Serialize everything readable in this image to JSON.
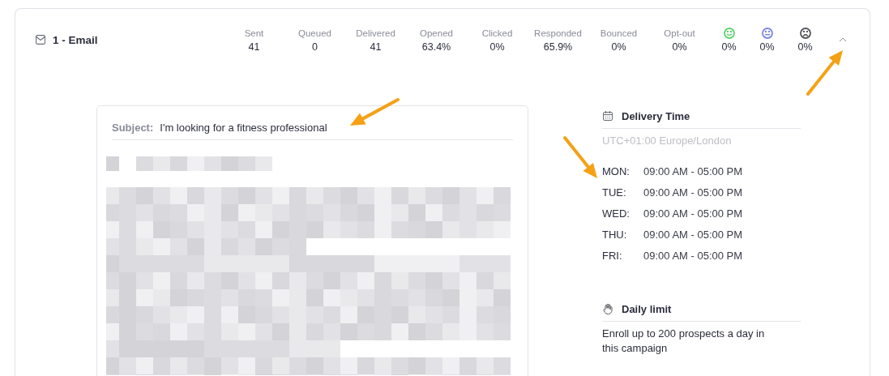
{
  "step": {
    "title": "1 - Email",
    "expanded": true
  },
  "stats": [
    {
      "kind": "text",
      "label": "Sent",
      "value": "41"
    },
    {
      "kind": "text",
      "label": "Queued",
      "value": "0"
    },
    {
      "kind": "text",
      "label": "Delivered",
      "value": "41"
    },
    {
      "kind": "text",
      "label": "Opened",
      "value": "63.4%"
    },
    {
      "kind": "text",
      "label": "Clicked",
      "value": "0%"
    },
    {
      "kind": "text",
      "label": "Responded",
      "value": "65.9%"
    },
    {
      "kind": "text",
      "label": "Bounced",
      "value": "0%"
    },
    {
      "kind": "text",
      "label": "Opt-out",
      "value": "0%"
    },
    {
      "kind": "smile",
      "color": "#5ed36b",
      "value": "0%"
    },
    {
      "kind": "neutral",
      "color": "#7b86e8",
      "value": "0%"
    },
    {
      "kind": "frown",
      "color": "#55565e",
      "value": "0%"
    }
  ],
  "email": {
    "subject_label": "Subject:",
    "subject": "I'm looking for a fitness professional"
  },
  "delivery_time": {
    "title": "Delivery Time",
    "timezone": "UTC+01:00 Europe/London",
    "days": [
      {
        "day": "MON:",
        "hours": "09:00 AM - 05:00 PM"
      },
      {
        "day": "TUE:",
        "hours": "09:00 AM - 05:00 PM"
      },
      {
        "day": "WED:",
        "hours": "09:00 AM - 05:00 PM"
      },
      {
        "day": "THU:",
        "hours": "09:00 AM - 05:00 PM"
      },
      {
        "day": "FRI:",
        "hours": "09:00 AM - 05:00 PM"
      }
    ]
  },
  "daily_limit": {
    "title": "Daily limit",
    "text": "Enroll up to 200 prospects a day in this campaign"
  }
}
